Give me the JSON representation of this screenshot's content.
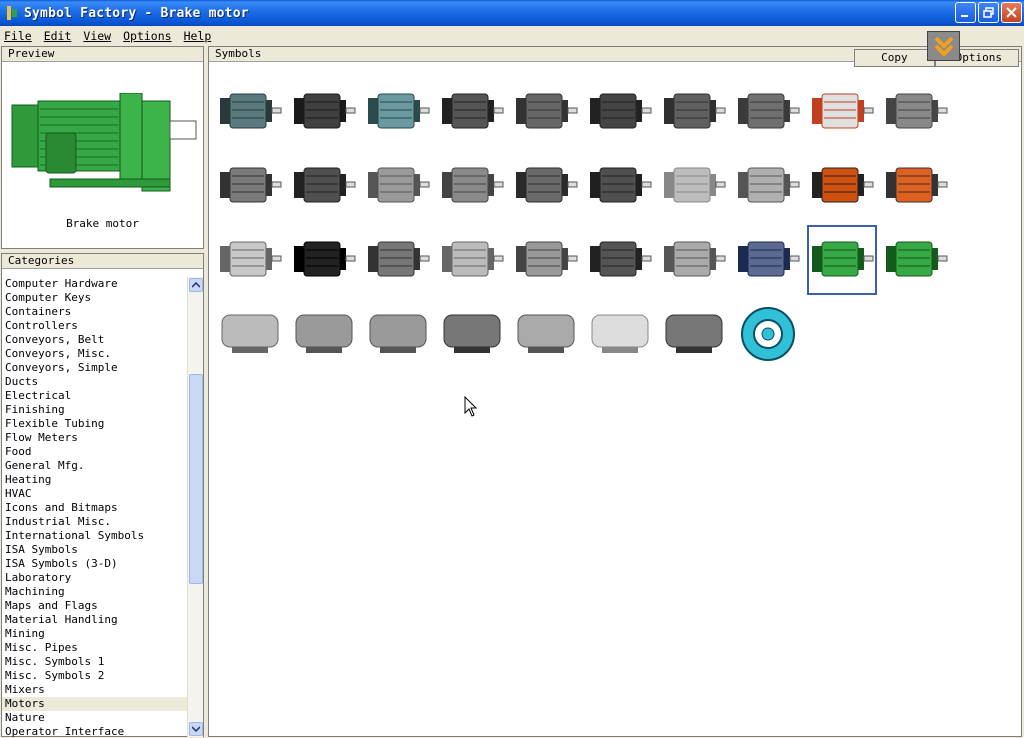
{
  "window": {
    "title": "Symbol Factory - Brake motor"
  },
  "menu": [
    "File",
    "Edit",
    "View",
    "Options",
    "Help"
  ],
  "preview": {
    "header": "Preview",
    "caption": "Brake motor"
  },
  "categories": {
    "header": "Categories",
    "items": [
      "Computer Hardware",
      "Computer Keys",
      "Containers",
      "Controllers",
      "Conveyors, Belt",
      "Conveyors, Misc.",
      "Conveyors, Simple",
      "Ducts",
      "Electrical",
      "Finishing",
      "Flexible Tubing",
      "Flow Meters",
      "Food",
      "General Mfg.",
      "Heating",
      "HVAC",
      "Icons and Bitmaps",
      "Industrial Misc.",
      "International Symbols",
      "ISA Symbols",
      "ISA Symbols (3-D)",
      "Laboratory",
      "Machining",
      "Maps and Flags",
      "Material Handling",
      "Mining",
      "Misc. Pipes",
      "Misc. Symbols 1",
      "Misc. Symbols 2",
      "Mixers",
      "Motors",
      "Nature",
      "Operator Interface"
    ],
    "selected": "Motors"
  },
  "symbols": {
    "header": "Symbols",
    "copy_label": "Copy",
    "options_label": "Options",
    "selected_index": 28
  },
  "colors": {
    "title_bar": "#0a56d4",
    "selection_border": "#3b5fae",
    "motor_green": "#2e9a3a"
  }
}
